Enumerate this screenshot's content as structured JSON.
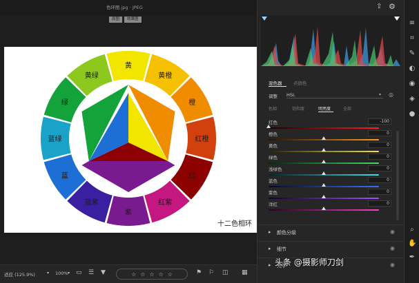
{
  "titlebar": {
    "filename": "色环图.jpg · JPEG"
  },
  "view_buttons": [
    "原图",
    "效果图"
  ],
  "caption": "十二色相环",
  "wheel": {
    "outer_segments": [
      {
        "label": "黄",
        "color": "#f2e600"
      },
      {
        "label": "黄橙",
        "color": "#f5c000"
      },
      {
        "label": "橙",
        "color": "#f08c00"
      },
      {
        "label": "红橙",
        "color": "#d2410d"
      },
      {
        "label": "红",
        "color": "#8c0000"
      },
      {
        "label": "红紫",
        "color": "#c4177f"
      },
      {
        "label": "紫",
        "color": "#7a1a90"
      },
      {
        "label": "蓝紫",
        "color": "#3a1fa0"
      },
      {
        "label": "蓝",
        "color": "#1d6fd6"
      },
      {
        "label": "蓝绿",
        "color": "#1aa3c8"
      },
      {
        "label": "绿",
        "color": "#14a23b"
      },
      {
        "label": "黄绿",
        "color": "#8cc81e"
      }
    ]
  },
  "bottombar": {
    "fit_label": "适应 (125.9%)",
    "zoom": "100%"
  },
  "panel": {
    "tabs": [
      "混色器",
      "点颜色"
    ],
    "adjust_label": "调整",
    "adjust_value": "HSL",
    "subtabs": [
      "色相",
      "饱和度",
      "明亮度",
      "全部"
    ],
    "sliders": [
      {
        "label": "红色",
        "value": "-100",
        "pos": 0.0,
        "gradient": "linear-gradient(90deg,#1a0000,#ff2020)"
      },
      {
        "label": "橙色",
        "value": "0",
        "pos": 0.5,
        "gradient": "linear-gradient(90deg,#2a1200,#ff9a20)"
      },
      {
        "label": "黄色",
        "value": "0",
        "pos": 0.5,
        "gradient": "linear-gradient(90deg,#2a2600,#f5e640)"
      },
      {
        "label": "绿色",
        "value": "0",
        "pos": 0.5,
        "gradient": "linear-gradient(90deg,#002a08,#40e060)"
      },
      {
        "label": "浅绿色",
        "value": "0",
        "pos": 0.5,
        "gradient": "linear-gradient(90deg,#00262a,#40e0e8)"
      },
      {
        "label": "蓝色",
        "value": "0",
        "pos": 0.5,
        "gradient": "linear-gradient(90deg,#00082a,#3a70ff)"
      },
      {
        "label": "紫色",
        "value": "0",
        "pos": 0.5,
        "gradient": "linear-gradient(90deg,#12002a,#a050ff)"
      },
      {
        "label": "洋红",
        "value": "0",
        "pos": 0.5,
        "gradient": "linear-gradient(90deg,#2a0022,#ff40c8)"
      }
    ],
    "sections": [
      "颜色分级",
      "细节",
      "光学"
    ]
  },
  "watermark": "头条 @摄影师刀剑"
}
